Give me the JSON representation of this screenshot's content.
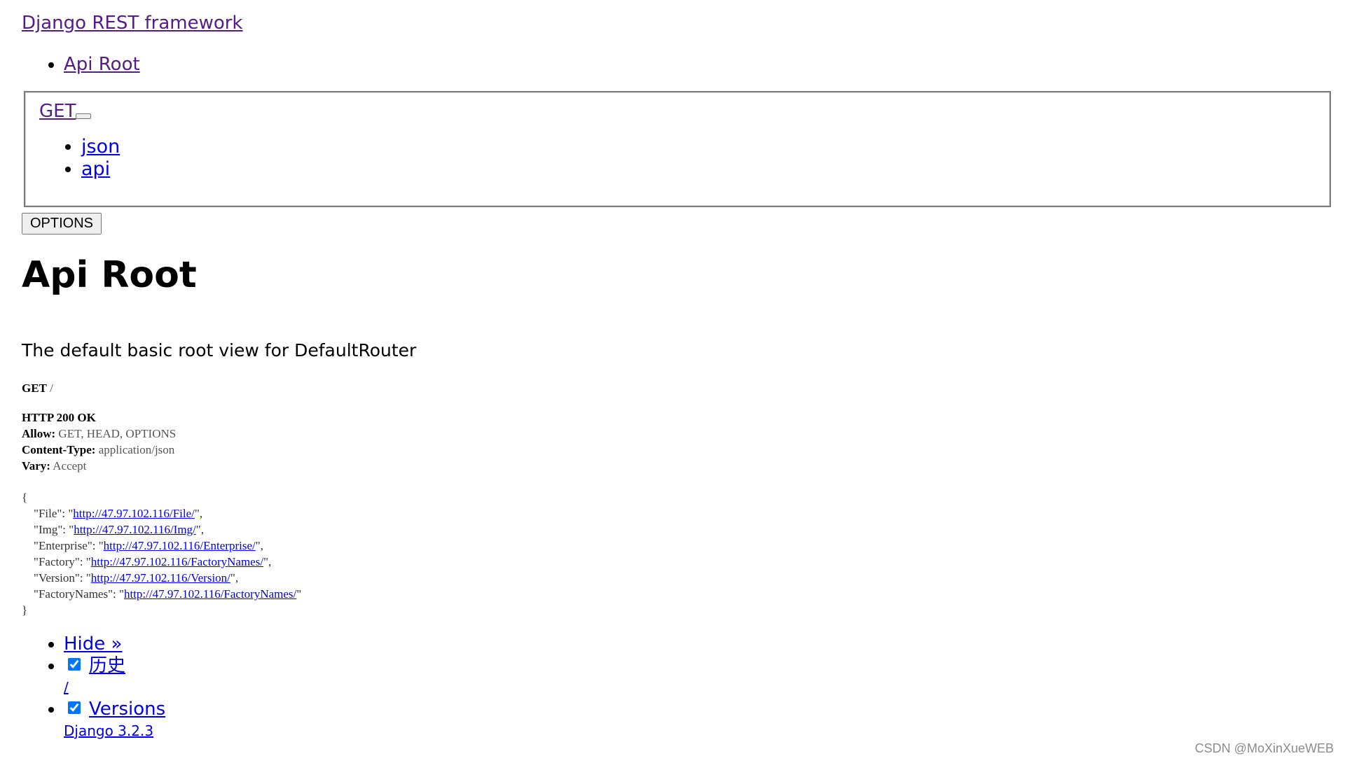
{
  "navbar": {
    "brand": "Django REST framework"
  },
  "breadcrumbs": [
    {
      "label": "Api Root"
    }
  ],
  "get_form": {
    "get_label": "GET",
    "formats": [
      {
        "label": "json"
      },
      {
        "label": "api"
      }
    ]
  },
  "options_button": "OPTIONS",
  "content": {
    "title": "Api Root",
    "description": "The default basic root view for DefaultRouter"
  },
  "request": {
    "method": "GET",
    "path": "/"
  },
  "response": {
    "status": "HTTP 200 OK",
    "headers": [
      {
        "name": "Allow:",
        "value": "GET, HEAD, OPTIONS"
      },
      {
        "name": "Content-Type:",
        "value": "application/json"
      },
      {
        "name": "Vary:",
        "value": "Accept"
      }
    ],
    "open_brace": "{",
    "close_brace": "}",
    "body": [
      {
        "key": "File",
        "url": "http://47.97.102.116/File/"
      },
      {
        "key": "Img",
        "url": "http://47.97.102.116/Img/"
      },
      {
        "key": "Enterprise",
        "url": "http://47.97.102.116/Enterprise/"
      },
      {
        "key": "Factory",
        "url": "http://47.97.102.116/FactoryNames/"
      },
      {
        "key": "Version",
        "url": "http://47.97.102.116/Version/"
      },
      {
        "key": "FactoryNames",
        "url": "http://47.97.102.116/FactoryNames/"
      }
    ]
  },
  "debug_toolbar": {
    "hide_label": "Hide »",
    "history_label": "历史",
    "history_sub": "/",
    "versions_label": "Versions",
    "versions_sub": "Django 3.2.3"
  },
  "watermark": "CSDN @MoXinXueWEB"
}
